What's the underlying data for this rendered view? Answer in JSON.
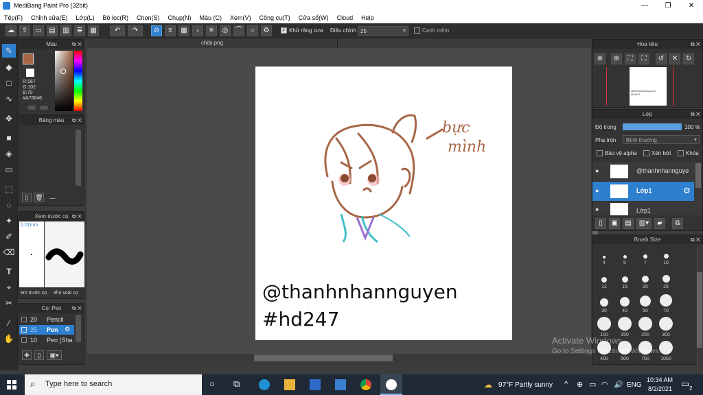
{
  "window": {
    "title": "MediBang Paint Pro (32bit)",
    "minimize": "—",
    "maximize": "❐",
    "close": "✕"
  },
  "menu": [
    "Tệp(F)",
    "Chỉnh sửa(E)",
    "Lớp(L)",
    "Bộ lọc(R)",
    "Chọn(S)",
    "Chụp(N)",
    "Màu (C)",
    "Xem(V)",
    "Công cụ(T)",
    "Cửa sổ(W)",
    "Cloud",
    "Help"
  ],
  "toolbar": {
    "antialias_label": "Khử răng cưa",
    "adjust_label": "Điều chỉnh",
    "adjust_value": "25",
    "smooth_edge_label": "Cạnh mềm"
  },
  "color_panel": {
    "title": "Màu",
    "r": "R:167",
    "g": "G:102",
    "b": "B:70",
    "hex": "#A76646",
    "swatch": "#A76646"
  },
  "palette_panel": {
    "title": "Bảng màu",
    "footer": "---"
  },
  "preview_panel": {
    "title": "Xem trước cọ",
    "size": "1.01mm",
    "tab1": "em trước cọ",
    "tab2": "iểm soát cọ"
  },
  "brush_panel": {
    "title": "Cọ: Pen",
    "items": [
      {
        "size": "20",
        "name": "Pencil"
      },
      {
        "size": "25",
        "name": "Pen"
      },
      {
        "size": "10",
        "name": "Pen (Sha"
      }
    ]
  },
  "document": {
    "tab": "chibi.png",
    "doodle_text": "bực\nmình",
    "caption_line1": "@thanhnhannguyen",
    "caption_line2": "#hd247"
  },
  "navigator_panel": {
    "title": "Hoa tiêu",
    "thumb_text": "@thanhnhannguyen\n#hd247"
  },
  "layer_panel": {
    "title": "Lớp",
    "opacity_label": "Độ trong",
    "opacity_value": "100 %",
    "opacity_fraction": 1.0,
    "blend_label": "Pha trộn",
    "blend_value": "Bình thường",
    "protect_alpha": "Bảo vệ alpha",
    "clipping": "Xén bớt",
    "lock": "Khóa",
    "layers": [
      {
        "name": "@thanhnhannguye",
        "selected": false
      },
      {
        "name": "Lớp1",
        "selected": true
      },
      {
        "name": "Lớp1",
        "selected": false
      }
    ]
  },
  "brushsize_panel": {
    "title": "Brush Size",
    "sizes": [
      "4",
      "5",
      "7",
      "10",
      "12",
      "15",
      "20",
      "25",
      "30",
      "40",
      "50",
      "70",
      "100",
      "150",
      "200",
      "300",
      "400",
      "500",
      "700",
      "1000"
    ]
  },
  "watermark": {
    "line1": "Activate Windows",
    "line2": "Go to Settings to activate Windows."
  },
  "taskbar": {
    "search_placeholder": "Type here to search",
    "weather": "97°F  Partly sunny",
    "lang": "ENG",
    "time": "10:34 AM",
    "date": "8/2/2021",
    "notif_count": "2"
  },
  "colors": {
    "accent": "#2f7fcf",
    "ink": "#A76646",
    "teal": "#40c0c8",
    "purple": "#9a6fd0"
  }
}
